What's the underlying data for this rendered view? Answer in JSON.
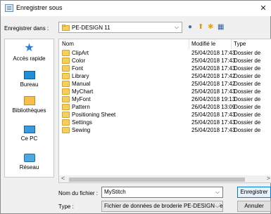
{
  "window": {
    "title": "Enregistrer sous",
    "close_glyph": "✕"
  },
  "lookin": {
    "label": "Enregistrer dans :",
    "value": "PE-DESIGN 11",
    "caret": "⌵"
  },
  "toolbar_icons": [
    "back-icon",
    "up-folder-icon",
    "new-folder-icon",
    "view-menu-icon"
  ],
  "places": [
    {
      "label": "Accès rapide",
      "icon": "star-icon"
    },
    {
      "label": "Bureau",
      "icon": "desktop-icon"
    },
    {
      "label": "Bibliothèques",
      "icon": "libraries-icon"
    },
    {
      "label": "Ce PC",
      "icon": "computer-icon"
    },
    {
      "label": "Réseau",
      "icon": "network-icon"
    }
  ],
  "list": {
    "columns": {
      "name": "Nom",
      "date": "Modifié le",
      "type": "Type",
      "sort_glyph": "^"
    },
    "rows": [
      {
        "name": "ClipArt",
        "date": "25/04/2018 17:43",
        "type": "Dossier de"
      },
      {
        "name": "Color",
        "date": "25/04/2018 17:43",
        "type": "Dossier de"
      },
      {
        "name": "Font",
        "date": "25/04/2018 17:43",
        "type": "Dossier de"
      },
      {
        "name": "Library",
        "date": "25/04/2018 17:42",
        "type": "Dossier de"
      },
      {
        "name": "Manual",
        "date": "25/04/2018 17:42",
        "type": "Dossier de"
      },
      {
        "name": "MyChart",
        "date": "25/04/2018 17:43",
        "type": "Dossier de"
      },
      {
        "name": "MyFont",
        "date": "26/04/2018 19:13",
        "type": "Dossier de"
      },
      {
        "name": "Pattern",
        "date": "26/04/2018 13:09",
        "type": "Dossier de"
      },
      {
        "name": "Positioning Sheet",
        "date": "25/04/2018 17:43",
        "type": "Dossier de"
      },
      {
        "name": "Settings",
        "date": "25/04/2018 17:43",
        "type": "Dossier de"
      },
      {
        "name": "Sewing",
        "date": "25/04/2018 17:43",
        "type": "Dossier de"
      }
    ],
    "scroll_left": "<",
    "scroll_right": ">"
  },
  "filename": {
    "label": "Nom du fichier :",
    "value": "MyStitch",
    "caret": "⌵"
  },
  "filetype": {
    "label": "Type :",
    "value": "Fichier de données de broderie PE-DESIGN Ve",
    "caret": "⌵"
  },
  "buttons": {
    "save": "Enregistrer",
    "cancel": "Annuler"
  },
  "colors": {
    "accent": "#0078d7",
    "folder": "#f5cf5a"
  }
}
